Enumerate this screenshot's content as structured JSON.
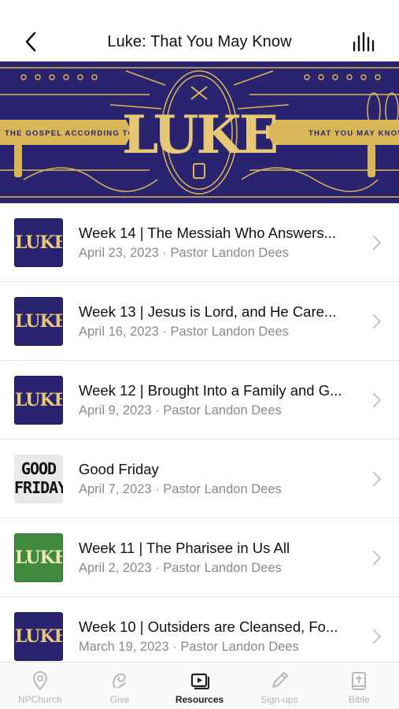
{
  "header": {
    "title": "Luke: That You May Know",
    "back_icon": "chevron-left-icon",
    "audio_icon": "audio-bars-icon"
  },
  "banner": {
    "left_text": "THE GOSPEL ACCORDING TO",
    "title": "LUKE",
    "right_text": "THAT YOU MAY KNOW",
    "colors": {
      "navy": "#2a2470",
      "gold": "#d9b657"
    }
  },
  "sermons": [
    {
      "title": "Week 14 | The Messiah Who Answers...",
      "date": "April 23, 2023",
      "speaker": "Pastor Landon Dees",
      "thumb": "luke",
      "sub": "April 23, 2023 · Pastor Landon Dees"
    },
    {
      "title": "Week 13 | Jesus is Lord, and He Care...",
      "date": "April 16, 2023",
      "speaker": "Pastor Landon Dees",
      "thumb": "luke",
      "sub": "April 16, 2023 · Pastor Landon Dees"
    },
    {
      "title": "Week 12 | Brought Into a Family and G...",
      "date": "April 9, 2023",
      "speaker": "Pastor Landon Dees",
      "thumb": "luke",
      "sub": "April 9, 2023 · Pastor Landon Dees"
    },
    {
      "title": "Good Friday",
      "date": "April 7, 2023",
      "speaker": "Pastor Landon Dees",
      "thumb": "good-friday",
      "sub": "April 7, 2023 · Pastor Landon Dees",
      "thumb_text": [
        "GOOD",
        "FRIDAY"
      ]
    },
    {
      "title": "Week 11 | The Pharisee in Us All",
      "date": "April 2, 2023",
      "speaker": "Pastor Landon Dees",
      "thumb": "luke-green",
      "sub": "April 2, 2023 · Pastor Landon Dees"
    },
    {
      "title": "Week 10 | Outsiders are Cleansed, Fo...",
      "date": "March 19, 2023",
      "speaker": "Pastor Landon Dees",
      "thumb": "luke",
      "sub": "March 19, 2023 · Pastor Landon Dees"
    }
  ],
  "tabs": [
    {
      "label": "NPChurch",
      "icon": "location-pin-icon",
      "active": false
    },
    {
      "label": "Give",
      "icon": "give-icon",
      "active": false
    },
    {
      "label": "Resources",
      "icon": "media-play-icon",
      "active": true
    },
    {
      "label": "Sign-ups",
      "icon": "pencil-icon",
      "active": false
    },
    {
      "label": "Bible",
      "icon": "bible-icon",
      "active": false
    }
  ],
  "thumb_word": "LUKE"
}
